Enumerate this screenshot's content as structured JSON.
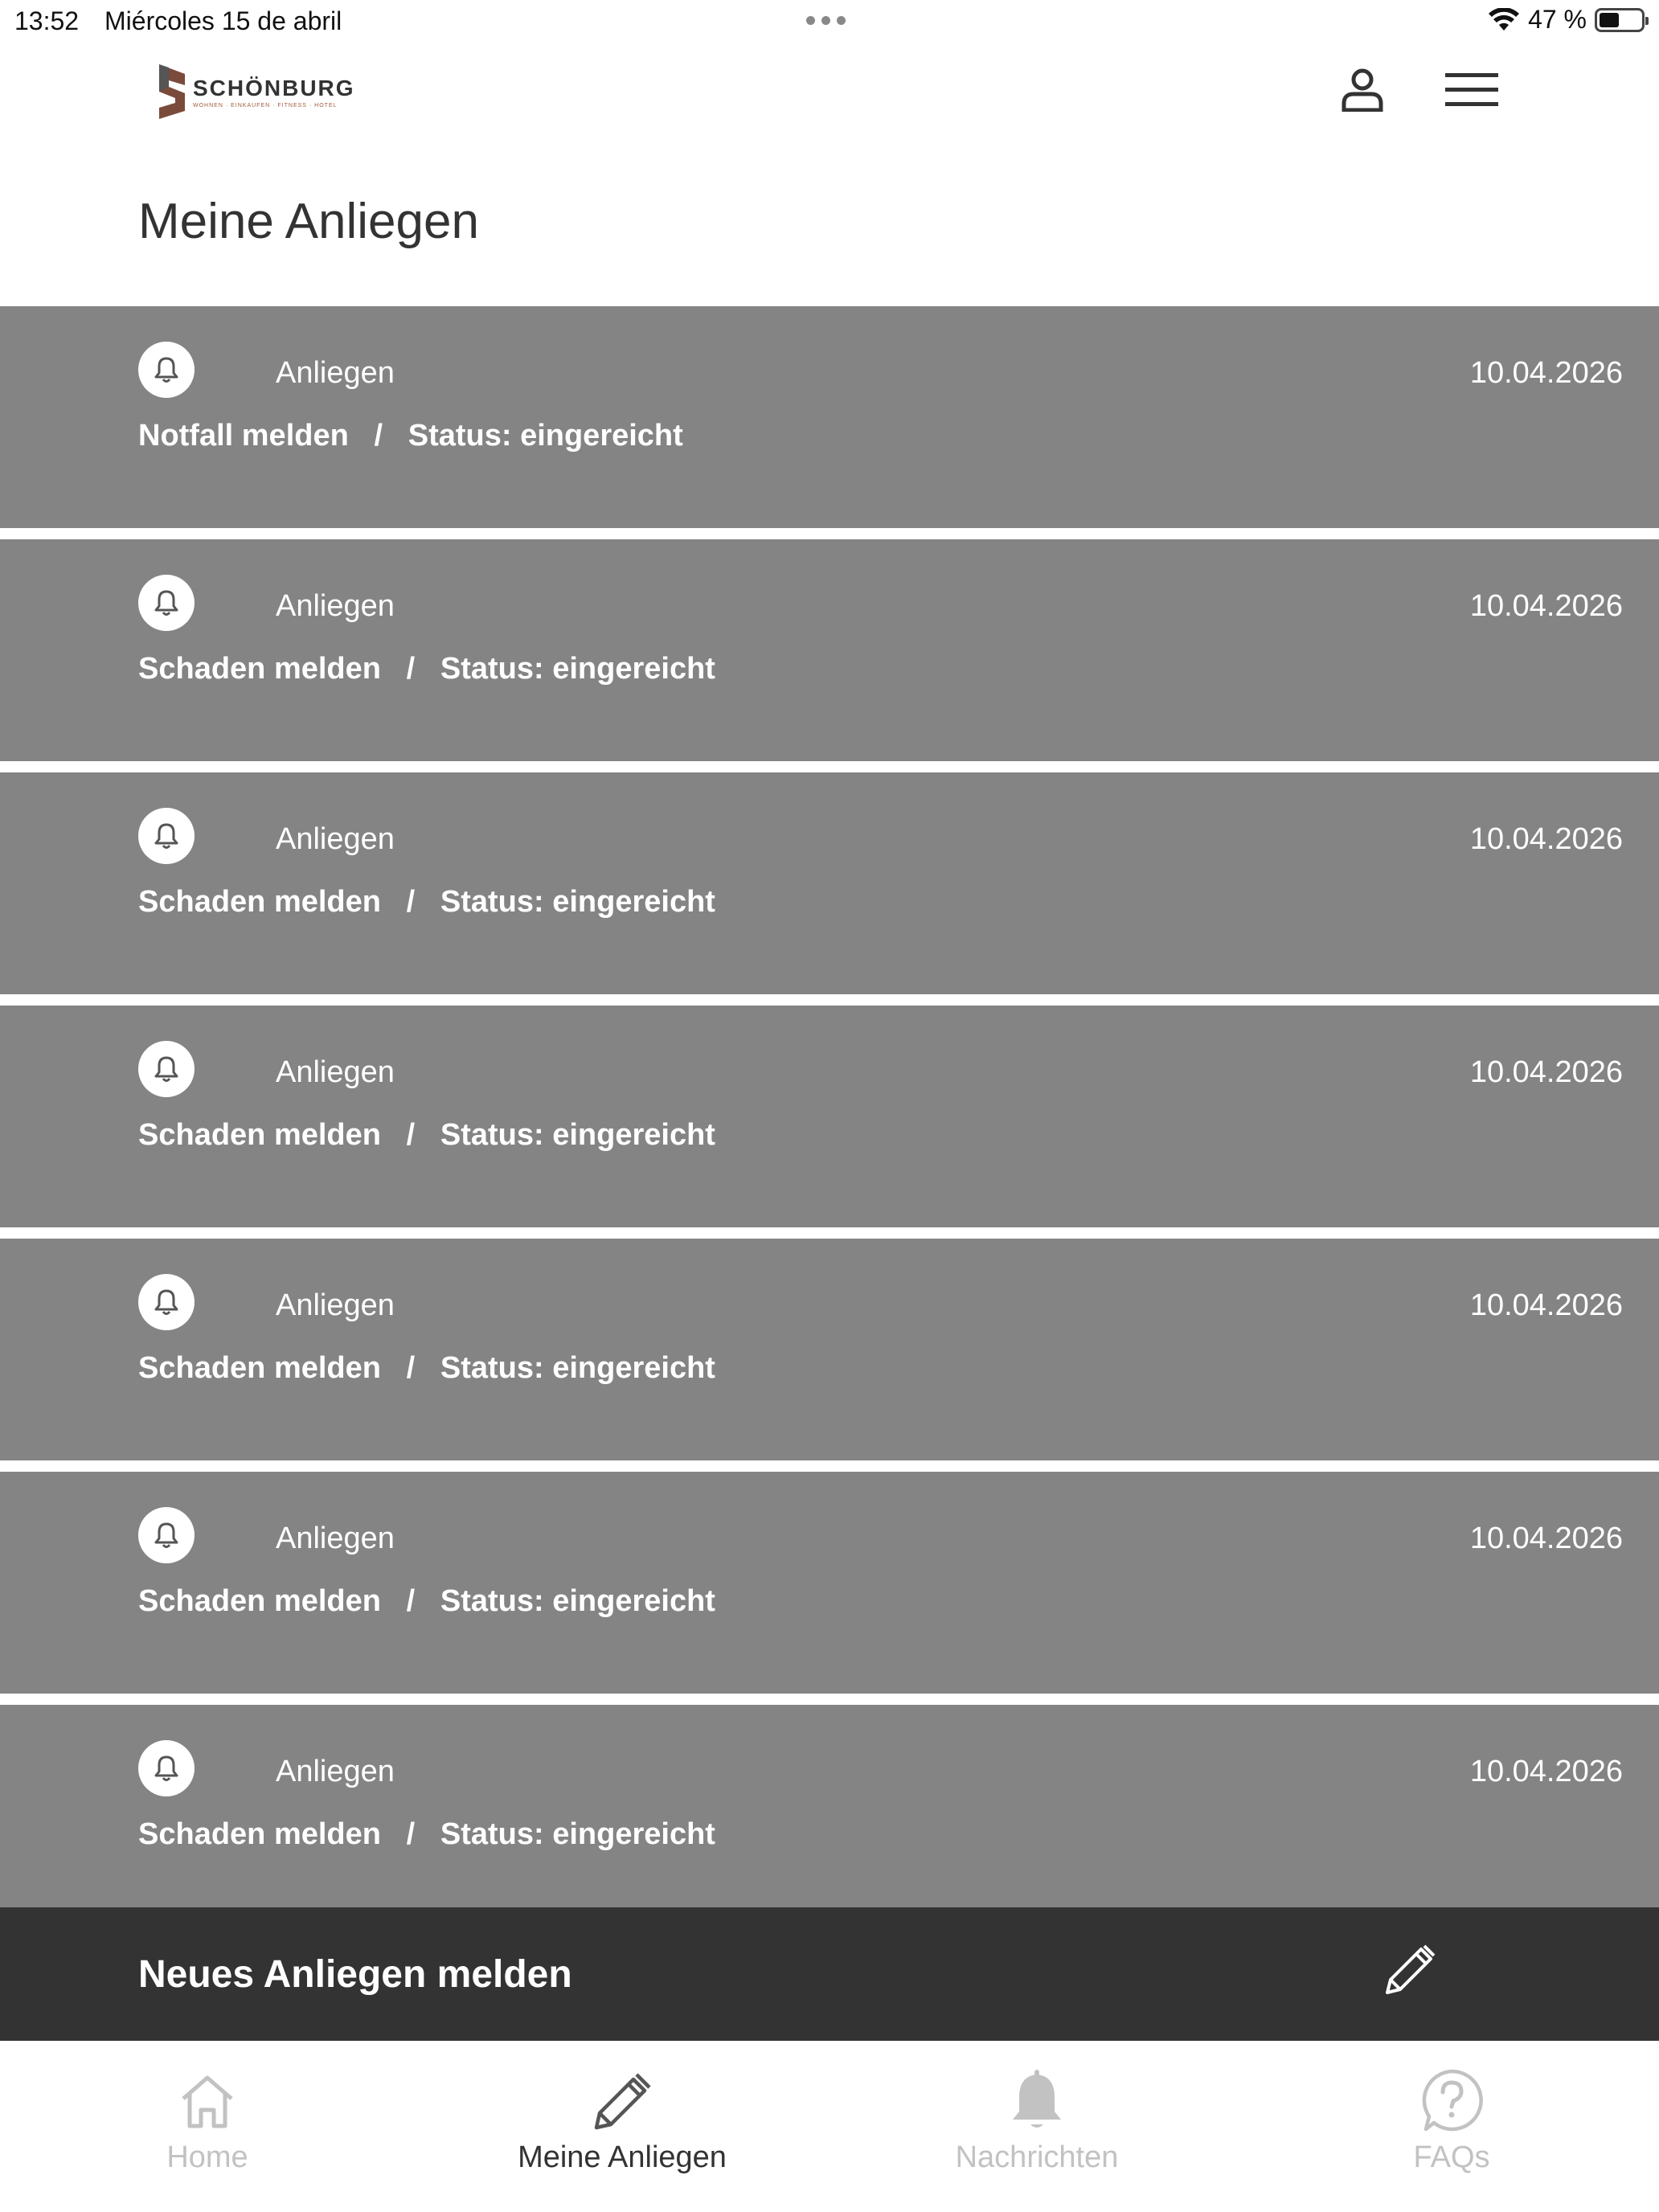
{
  "status_bar": {
    "time": "13:52",
    "date": "Miércoles 15 de abril",
    "battery_percent": "47 %",
    "battery_level": 0.47
  },
  "header": {
    "logo": {
      "name": "SCHÖNBURG",
      "tagline": "WOHNEN · EINKAUFEN · FITNESS · HOTEL"
    },
    "profile_icon": "person-icon",
    "menu_icon": "hamburger-icon"
  },
  "page": {
    "title": "Meine Anliegen"
  },
  "requests": [
    {
      "type": "Anliegen",
      "date": "10.04.2026",
      "title": "Notfall melden",
      "status": "Status: eingereicht"
    },
    {
      "type": "Anliegen",
      "date": "10.04.2026",
      "title": "Schaden melden",
      "status": "Status: eingereicht"
    },
    {
      "type": "Anliegen",
      "date": "10.04.2026",
      "title": "Schaden melden",
      "status": "Status: eingereicht"
    },
    {
      "type": "Anliegen",
      "date": "10.04.2026",
      "title": "Schaden melden",
      "status": "Status: eingereicht"
    },
    {
      "type": "Anliegen",
      "date": "10.04.2026",
      "title": "Schaden melden",
      "status": "Status: eingereicht"
    },
    {
      "type": "Anliegen",
      "date": "10.04.2026",
      "title": "Schaden melden",
      "status": "Status: eingereicht"
    },
    {
      "type": "Anliegen",
      "date": "10.04.2026",
      "title": "Schaden melden",
      "status": "Status: eingereicht"
    }
  ],
  "cta": {
    "label": "Neues Anliegen melden",
    "icon": "pencil-icon"
  },
  "tabbar": {
    "tabs": [
      {
        "label": "Home",
        "icon": "home-icon",
        "active": false
      },
      {
        "label": "Meine Anliegen",
        "icon": "pencil-icon",
        "active": true
      },
      {
        "label": "Nachrichten",
        "icon": "bell-icon",
        "active": false
      },
      {
        "label": "FAQs",
        "icon": "question-icon",
        "active": false
      }
    ]
  },
  "colors": {
    "item_bg": "#848484",
    "cta_bg": "#333333",
    "tab_inactive": "#c2c2c2",
    "tab_active": "#333333",
    "logo_accent": "#a05a3c"
  }
}
